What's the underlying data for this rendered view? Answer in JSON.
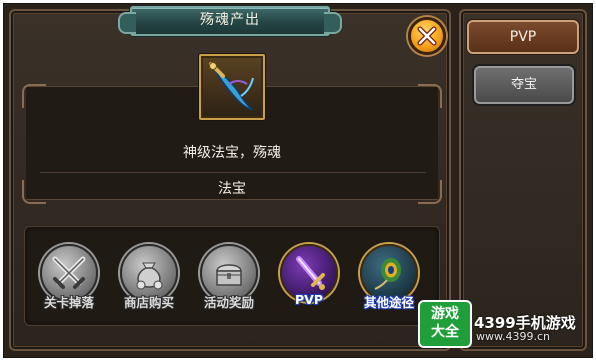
{
  "dialog": {
    "title": "殇魂产出",
    "item_name": "神级法宝，殇魂",
    "item_type": "法宝"
  },
  "sources": [
    {
      "label": "关卡掉落",
      "icon": "crossed-swords-icon"
    },
    {
      "label": "商店购买",
      "icon": "money-bag-icon"
    },
    {
      "label": "活动奖励",
      "icon": "treasure-chest-icon"
    },
    {
      "label": "PVP",
      "icon": "purple-sword-icon"
    },
    {
      "label": "其他途径",
      "icon": "peacock-feather-icon"
    }
  ],
  "tabs": [
    {
      "label": "PVP",
      "active": true
    },
    {
      "label": "夺宝",
      "active": false
    }
  ],
  "watermark": {
    "badge_line1": "游戏",
    "badge_line2": "大全",
    "site_name": "4399手机游戏",
    "url": "www.4399.cn"
  },
  "colors": {
    "panel_border": "#6c5540",
    "title_plate": "#244543",
    "close_button": "#f6a21c",
    "active_tab": "#5a3018"
  }
}
